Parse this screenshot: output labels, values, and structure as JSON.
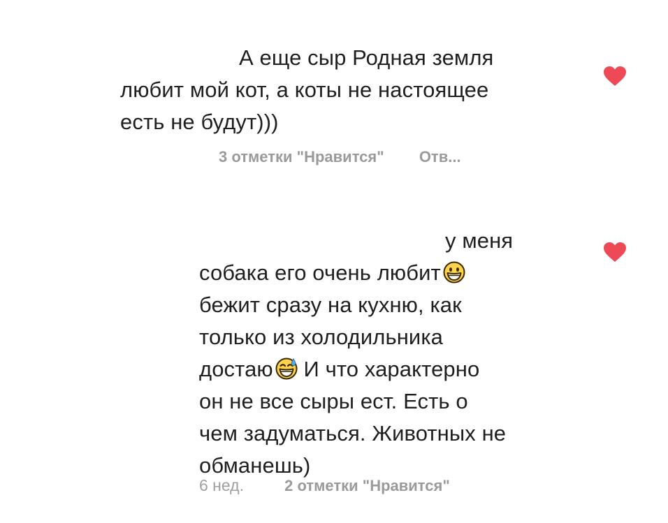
{
  "comments": [
    {
      "text_lines": [
        "А еще сыр Родная земля",
        "любит мой кот, а коты не настоящее",
        "есть не будут)))"
      ],
      "likes_label": "3 отметки \"Нравится\"",
      "reply_label": "Отв...",
      "liked": true,
      "heart_color": "#ed4956"
    },
    {
      "text_lines": [
        "у меня",
        "собака его очень любит",
        "бежит сразу на кухню, как",
        "только из холодильника",
        "достаю",
        " И что характерно",
        "он не все сыры ест. Есть о",
        "чем задуматься. Животных не",
        "обманешь)"
      ],
      "time": "6 нед.",
      "likes_label": "2 отметки \"Нравится\"",
      "liked": true,
      "heart_color": "#ed4956",
      "emojis": [
        "grinning-face-icon",
        "grinning-face-with-sweat-icon"
      ]
    }
  ]
}
